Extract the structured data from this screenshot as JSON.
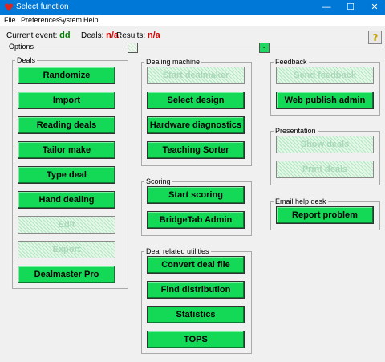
{
  "window": {
    "title": "Select function"
  },
  "menu": [
    "File",
    "Preferences",
    "System",
    "Help"
  ],
  "status": {
    "current_event_label": "Current event:",
    "current_event_value": "dd",
    "deals_label": "Deals:",
    "deals_value": "n/a",
    "results_label": "Results:",
    "results_value": "n/a"
  },
  "options_label": "Options",
  "groups": {
    "deals": {
      "label": "Deals",
      "buttons": [
        "Randomize",
        "Import",
        "Reading deals",
        "Tailor make",
        "Type deal",
        "Hand dealing",
        "Edit",
        "Export",
        "Dealmaster Pro"
      ]
    },
    "dealing_machine": {
      "label": "Dealing machine",
      "buttons": [
        "Start dealmaker",
        "Select design",
        "Hardware diagnostics",
        "Teaching Sorter"
      ]
    },
    "scoring": {
      "label": "Scoring",
      "buttons": [
        "Start scoring",
        "BridgeTab Admin"
      ]
    },
    "utilities": {
      "label": "Deal related utilities",
      "buttons": [
        "Convert deal file",
        "Find distribution",
        "Statistics",
        "TOPS"
      ]
    },
    "feedback": {
      "label": "Feedback",
      "buttons": [
        "Send feedback",
        "Web publish admin"
      ]
    },
    "presentation": {
      "label": "Presentation",
      "buttons": [
        "Show deals",
        "Print deals"
      ]
    },
    "email": {
      "label": "Email help desk",
      "buttons": [
        "Report problem"
      ]
    }
  },
  "colors": {
    "button_green": "#13d957",
    "titlebar": "#0078d7",
    "value_red": "#e00000",
    "value_green": "#008000"
  }
}
